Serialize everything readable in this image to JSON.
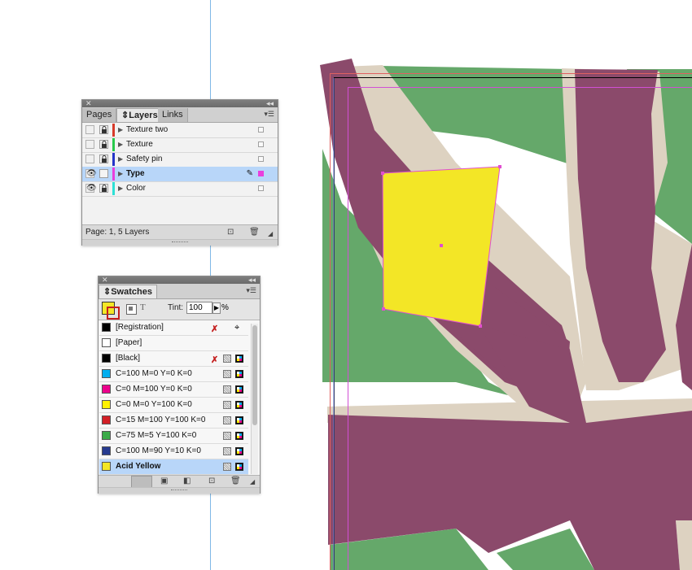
{
  "colors": {
    "canvas_bg": "#ffffff",
    "purple": "#8b4a6b",
    "green": "#65a86a",
    "beige": "#ddd2c1",
    "yellow": "#f3e626",
    "guide_blue": "#7fb8e6",
    "margin_magenta": "#d24fd5",
    "selection_blue": "#b8d6f9"
  },
  "layers_panel": {
    "tabs": [
      "Pages",
      "Layers",
      "Links"
    ],
    "active_tab": "Layers",
    "layers": [
      {
        "name": "Texture two",
        "visible": false,
        "locked": true,
        "color": "#d73a2a",
        "selected": false
      },
      {
        "name": "Texture",
        "visible": false,
        "locked": true,
        "color": "#27c94b",
        "selected": false
      },
      {
        "name": "Safety pin",
        "visible": false,
        "locked": true,
        "color": "#2435c8",
        "selected": false
      },
      {
        "name": "Type",
        "visible": true,
        "locked": false,
        "color": "#e93fdd",
        "selected": true
      },
      {
        "name": "Color",
        "visible": true,
        "locked": true,
        "color": "#2de0d6",
        "selected": false
      }
    ],
    "footer_text": "Page: 1, 5 Layers"
  },
  "swatches_panel": {
    "title": "Swatches",
    "tint_label": "Tint:",
    "tint_value": "100",
    "tint_unit": "%",
    "swatches": [
      {
        "name": "[Registration]",
        "chip": "#000000",
        "no_edit": true,
        "icon": "registration"
      },
      {
        "name": "[Paper]",
        "chip": "#ffffff",
        "no_edit": false,
        "icon": ""
      },
      {
        "name": "[Black]",
        "chip": "#000000",
        "no_edit": true,
        "icon": "process-cmyk"
      },
      {
        "name": "C=100 M=0 Y=0 K=0",
        "chip": "#00aeef",
        "no_edit": false,
        "icon": "process-cmyk"
      },
      {
        "name": "C=0 M=100 Y=0 K=0",
        "chip": "#ec008c",
        "no_edit": false,
        "icon": "process-cmyk"
      },
      {
        "name": "C=0 M=0 Y=100 K=0",
        "chip": "#fff200",
        "no_edit": false,
        "icon": "process-cmyk"
      },
      {
        "name": "C=15 M=100 Y=100 K=0",
        "chip": "#d31f26",
        "no_edit": false,
        "icon": "process-cmyk"
      },
      {
        "name": "C=75 M=5 Y=100 K=0",
        "chip": "#3aaa48",
        "no_edit": false,
        "icon": "process-cmyk"
      },
      {
        "name": "C=100 M=90 Y=10 K=0",
        "chip": "#263a8f",
        "no_edit": false,
        "icon": "process-cmyk"
      },
      {
        "name": "Acid Yellow",
        "chip": "#f3e626",
        "no_edit": false,
        "icon": "process-cmyk",
        "selected": true
      }
    ]
  }
}
